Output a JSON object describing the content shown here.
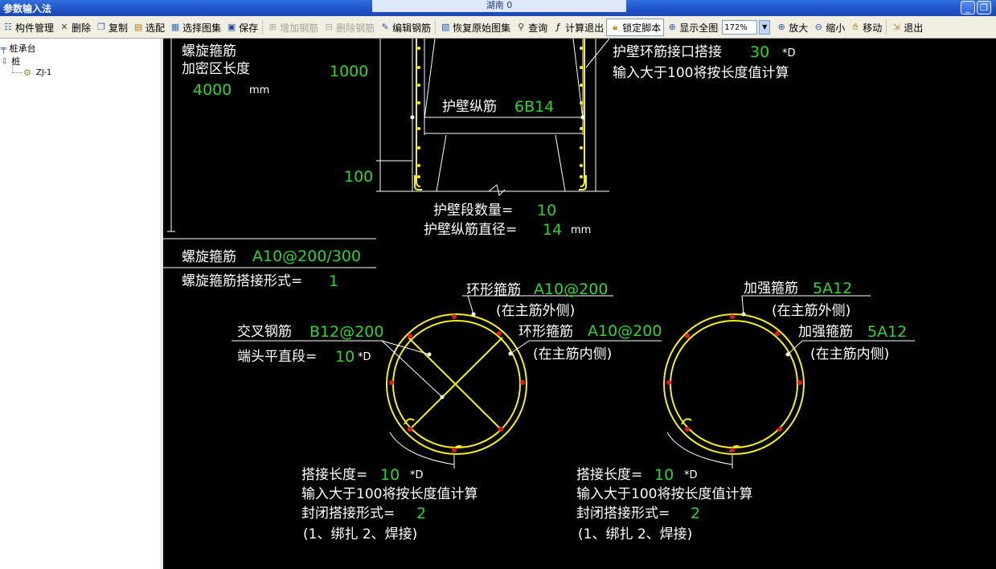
{
  "window": {
    "title": "参数输入法",
    "center_tab": "湖南 0"
  },
  "toolbar": {
    "items": [
      {
        "label": "构件管理",
        "icon": "component-manage-icon",
        "enabled": true
      },
      {
        "label": "删除",
        "icon": "delete-icon",
        "enabled": true
      },
      {
        "label": "复制",
        "icon": "copy-icon",
        "enabled": true
      },
      {
        "label": "选配",
        "icon": "select-config-icon",
        "enabled": true
      },
      {
        "label": "选择图集",
        "icon": "atlas-icon",
        "enabled": true
      },
      {
        "label": "保存",
        "icon": "save-icon",
        "enabled": true
      },
      {
        "label": "增加钢筋",
        "icon": "add-rebar-icon",
        "enabled": false
      },
      {
        "label": "删除钢筋",
        "icon": "delete-rebar-icon",
        "enabled": false
      },
      {
        "label": "编辑钢筋",
        "icon": "edit-rebar-icon",
        "enabled": true
      },
      {
        "label": "恢复原始图集",
        "icon": "restore-icon",
        "enabled": true
      },
      {
        "label": "查询",
        "icon": "query-icon",
        "enabled": true
      },
      {
        "label": "计算退出",
        "icon": "calc-exit-icon",
        "enabled": true
      },
      {
        "label": "锁定脚本",
        "icon": "lock-icon",
        "enabled": true
      },
      {
        "label": "显示全图",
        "icon": "show-all-icon",
        "enabled": true
      }
    ],
    "zoom_value": "172%",
    "right_items": [
      {
        "label": "放大",
        "icon": "zoom-in-icon"
      },
      {
        "label": "缩小",
        "icon": "zoom-out-icon"
      },
      {
        "label": "移动",
        "icon": "move-icon"
      },
      {
        "label": "退出",
        "icon": "exit-icon"
      }
    ]
  },
  "tree": {
    "root": "桩承台",
    "child": "桩",
    "leaf": "ZJ-1"
  },
  "drawing": {
    "spiral_label_1": "螺旋箍筋",
    "spiral_label_2": "加密区长度",
    "dense_length": "4000",
    "unit_mm": "mm",
    "dim_1000": "1000",
    "dim_100": "100",
    "wall_ring_lap_label": "护壁环筋接口搭接",
    "wall_ring_lap_value": "30",
    "times_d": "*D",
    "over100_note": "输入大于100将按长度值计算",
    "wall_long_label": "护壁纵筋",
    "wall_long_value": "6B14",
    "wall_seg_label": "护壁段数量=",
    "wall_seg_value": "10",
    "wall_dia_label": "护壁纵筋直径=",
    "wall_dia_value": "14",
    "spiral_stirrup_label": "螺旋箍筋",
    "spiral_stirrup_value": "A10@200/300",
    "spiral_lap_form_label": "螺旋箍筋搭接形式=",
    "spiral_lap_form_value": "1",
    "ring_stirrup_label": "环形箍筋",
    "ring_stirrup_value": "A10@200",
    "outside_main": "(在主筋外侧)",
    "inside_main": "(在主筋内侧)",
    "cross_label": "交叉钢筋",
    "cross_value": "B12@200",
    "end_straight_label": "端头平直段=",
    "end_straight_value": "10",
    "reinforce_label": "加强箍筋",
    "reinforce_value": "5A12",
    "lap_len_label": "搭接长度=",
    "lap_len_value": "10",
    "closed_lap_label": "封闭搭接形式=",
    "closed_lap_value": "2",
    "lap_options": "(1、绑扎  2、焊接)"
  },
  "colors": {
    "canvas_bg": "#000000",
    "value_green": "#2ed62e",
    "rebar_yellow": "#f5f016",
    "bar_red": "#e81818"
  }
}
